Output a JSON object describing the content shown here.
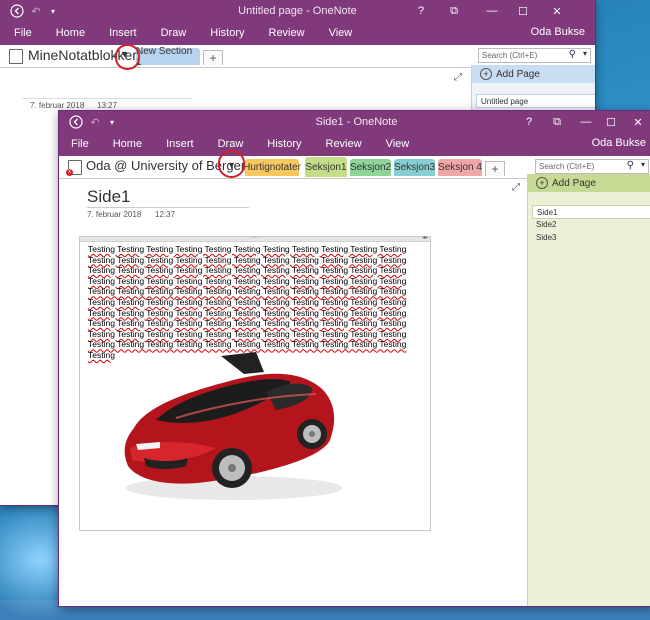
{
  "back_window": {
    "title": "Untitled page - OneNote",
    "ribbon": [
      "File",
      "Home",
      "Insert",
      "Draw",
      "History",
      "Review",
      "View"
    ],
    "user": "Oda Bukse",
    "controls": [
      "?",
      "⧉",
      "—",
      "☐",
      "✕"
    ],
    "notebook_name": "MineNotatblokker",
    "section_tab": "New Section 1",
    "add_tab": "+",
    "search_placeholder": "Search (Ctrl+E)",
    "add_page": "Add Page",
    "pages": [
      "Untitled page"
    ],
    "date": "7. februar 2018",
    "time": "13:27"
  },
  "front_window": {
    "title": "Side1 - OneNote",
    "ribbon": [
      "File",
      "Home",
      "Insert",
      "Draw",
      "History",
      "Review",
      "View"
    ],
    "user": "Oda Bukse",
    "controls": [
      "?",
      "⧉",
      "—",
      "☐",
      "✕"
    ],
    "notebook_name": "Oda @ University of Bergen",
    "sections": [
      {
        "label": "Hurtignotater",
        "color": "#f7c860"
      },
      {
        "label": "Seksjon1",
        "color": "#c4dd87"
      },
      {
        "label": "Seksjon2",
        "color": "#8ed49a"
      },
      {
        "label": "Seksjon3",
        "color": "#86cfd0"
      },
      {
        "label": "Seksjon 4",
        "color": "#f1a7a7"
      }
    ],
    "add_tab": "+",
    "search_placeholder": "Search (Ctrl+E)",
    "add_page": "Add Page",
    "pages": [
      "Side1",
      "Side2",
      "Side3"
    ],
    "page_title": "Side1",
    "date": "7. februar 2018",
    "time": "12:37",
    "body_word": "Testing",
    "body_word_count": 111
  },
  "colors": {
    "titlebar": "#80397b",
    "annotation": "#d1202a",
    "pages_pane": "#eaf1d6"
  }
}
